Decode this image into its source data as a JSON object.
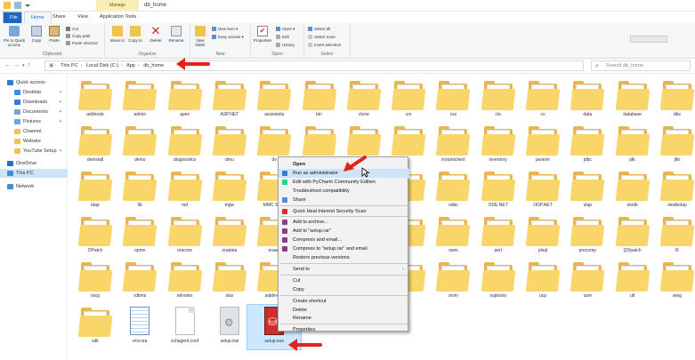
{
  "titlebar": {
    "manage_tab": "Manage",
    "title": "db_home"
  },
  "ribbon_tabs": [
    "File",
    "Home",
    "Share",
    "View",
    "Application Tools"
  ],
  "ribbon": {
    "clipboard": {
      "pin_label": "Pin to Quick access",
      "copy_label": "Copy",
      "paste_label": "Paste",
      "cut": "Cut",
      "copy_path": "Copy path",
      "paste_shortcut": "Paste shortcut",
      "group_label": "Clipboard"
    },
    "organize": {
      "move_to": "Move to",
      "copy_to": "Copy to",
      "delete": "Delete",
      "rename": "Rename",
      "group_label": "Organize"
    },
    "new": {
      "new_folder": "New folder",
      "new_item": "New item",
      "easy_access": "Easy access",
      "group_label": "New"
    },
    "open": {
      "properties": "Properties",
      "open": "Open",
      "edit": "Edit",
      "history": "History",
      "group_label": "Open"
    },
    "select": {
      "select_all": "Select all",
      "select_none": "Select none",
      "invert_selection": "Invert selection",
      "group_label": "Select"
    }
  },
  "address": {
    "crumbs": [
      "This PC",
      "Local Disk (C:)",
      "App",
      "db_home"
    ],
    "search_placeholder": "Search db_home"
  },
  "sidebar": [
    {
      "label": "Quick access",
      "color": "#2b7cd3",
      "indent": 0
    },
    {
      "label": "Desktop",
      "color": "#3c8ee0",
      "indent": 1,
      "pinned": true
    },
    {
      "label": "Downloads",
      "color": "#2f7fd6",
      "indent": 1,
      "pinned": true
    },
    {
      "label": "Documents",
      "color": "#8aa2b8",
      "indent": 1,
      "pinned": true
    },
    {
      "label": "Pictures",
      "color": "#5fa9e8",
      "indent": 1,
      "pinned": true
    },
    {
      "label": "Channel",
      "color": "#f2c14e",
      "indent": 1
    },
    {
      "label": "Website",
      "color": "#f2c14e",
      "indent": 1
    },
    {
      "label": "YouTube Setup",
      "color": "#f2c14e",
      "indent": 1,
      "pinned": true
    },
    {
      "label": "OneDrive",
      "color": "#1f6fd0",
      "indent": 0
    },
    {
      "label": "This PC",
      "color": "#3a8fd9",
      "indent": 0,
      "selected": true
    },
    {
      "label": "Network",
      "color": "#3a8fd9",
      "indent": 0
    }
  ],
  "items": [
    {
      "label": "addnode",
      "kind": "folder"
    },
    {
      "label": "admin",
      "kind": "folder"
    },
    {
      "label": "apex",
      "kind": "folder"
    },
    {
      "label": "ASP.NET",
      "kind": "folder"
    },
    {
      "label": "assistants",
      "kind": "folder"
    },
    {
      "label": "bin",
      "kind": "folder"
    },
    {
      "label": "clone",
      "kind": "folder"
    },
    {
      "label": "crs",
      "kind": "folder"
    },
    {
      "label": "css",
      "kind": "folder"
    },
    {
      "label": "ctx",
      "kind": "folder"
    },
    {
      "label": "cv",
      "kind": "folder"
    },
    {
      "label": "data",
      "kind": "folder"
    },
    {
      "label": "database",
      "kind": "folder"
    },
    {
      "label": "dbs",
      "kind": "folder"
    },
    {
      "label": "deinstall",
      "kind": "folder"
    },
    {
      "label": "demo",
      "kind": "folder"
    },
    {
      "label": "diagnostics",
      "kind": "folder"
    },
    {
      "label": "dmu",
      "kind": "folder"
    },
    {
      "label": "dv",
      "kind": "folder"
    },
    {
      "label": "",
      "kind": "folder"
    },
    {
      "label": "",
      "kind": "folder"
    },
    {
      "label": "",
      "kind": "folder"
    },
    {
      "label": "instantclient",
      "kind": "folder"
    },
    {
      "label": "inventory",
      "kind": "folder"
    },
    {
      "label": "javavm",
      "kind": "folder"
    },
    {
      "label": "jdbc",
      "kind": "folder"
    },
    {
      "label": "jdk",
      "kind": "folder"
    },
    {
      "label": "jlib",
      "kind": "folder"
    },
    {
      "label": "ldap",
      "kind": "folder"
    },
    {
      "label": "lib",
      "kind": "folder"
    },
    {
      "label": "md",
      "kind": "folder"
    },
    {
      "label": "mgw",
      "kind": "folder"
    },
    {
      "label": "MMC Snap",
      "kind": "folder"
    },
    {
      "label": "",
      "kind": "folder"
    },
    {
      "label": "",
      "kind": "folder"
    },
    {
      "label": "",
      "kind": "folder"
    },
    {
      "label": "odbc",
      "kind": "folder"
    },
    {
      "label": "ODE.NET",
      "kind": "folder"
    },
    {
      "label": "ODP.NET",
      "kind": "folder"
    },
    {
      "label": "olap",
      "kind": "folder"
    },
    {
      "label": "oledb",
      "kind": "folder"
    },
    {
      "label": "oledbolap",
      "kind": "folder"
    },
    {
      "label": "OPatch",
      "kind": "folder"
    },
    {
      "label": "opmn",
      "kind": "folder"
    },
    {
      "label": "oracore",
      "kind": "folder"
    },
    {
      "label": "oradata",
      "kind": "folder"
    },
    {
      "label": "orawe",
      "kind": "folder"
    },
    {
      "label": "",
      "kind": "folder"
    },
    {
      "label": "",
      "kind": "folder"
    },
    {
      "label": "",
      "kind": "folder"
    },
    {
      "label": "owm",
      "kind": "folder"
    },
    {
      "label": "perl",
      "kind": "folder"
    },
    {
      "label": "plsql",
      "kind": "folder"
    },
    {
      "label": "precomp",
      "kind": "folder"
    },
    {
      "label": "QOpatch",
      "kind": "folder"
    },
    {
      "label": "R",
      "kind": "folder"
    },
    {
      "label": "racg",
      "kind": "folder"
    },
    {
      "label": "rdbms",
      "kind": "folder"
    },
    {
      "label": "relnotes",
      "kind": "folder"
    },
    {
      "label": "slax",
      "kind": "folder"
    },
    {
      "label": "sqldevelo",
      "kind": "folder"
    },
    {
      "label": "",
      "kind": "folder"
    },
    {
      "label": "",
      "kind": "folder"
    },
    {
      "label": "",
      "kind": "folder"
    },
    {
      "label": "srvm",
      "kind": "folder"
    },
    {
      "label": "suptools",
      "kind": "folder"
    },
    {
      "label": "ucp",
      "kind": "folder"
    },
    {
      "label": "usm",
      "kind": "folder"
    },
    {
      "label": "utl",
      "kind": "folder"
    },
    {
      "label": "wwg",
      "kind": "folder"
    },
    {
      "label": "xdk",
      "kind": "folder"
    },
    {
      "label": "env.ora",
      "kind": "notepad"
    },
    {
      "label": "schagent.conf",
      "kind": "file"
    },
    {
      "label": "setup.bat",
      "kind": "bat"
    },
    {
      "label": "setup.exe",
      "kind": "exe",
      "selected": true
    }
  ],
  "context_menu": {
    "items": [
      {
        "label": "Open",
        "bold": true
      },
      {
        "label": "Run as administrator",
        "highlight": true,
        "icon": "#3a7bd5"
      },
      {
        "label": "Edit with PyCharm Community Edition",
        "icon": "#21d789"
      },
      {
        "label": "Troubleshoot compatibility"
      },
      {
        "label": "Share",
        "icon": "#4a90d9"
      },
      {
        "sep": true
      },
      {
        "label": "Quick Heal Internet Security Scan",
        "icon": "#d32f2f"
      },
      {
        "sep": true
      },
      {
        "label": "Add to archive...",
        "icon": "#8e3b8e"
      },
      {
        "label": "Add to \"setup.rar\"",
        "icon": "#8e3b8e"
      },
      {
        "label": "Compress and email...",
        "icon": "#8e3b8e"
      },
      {
        "label": "Compress to \"setup.rar\" and email",
        "icon": "#8e3b8e"
      },
      {
        "label": "Restore previous versions"
      },
      {
        "sep": true
      },
      {
        "label": "Send to",
        "submenu": true
      },
      {
        "sep": true
      },
      {
        "label": "Cut"
      },
      {
        "label": "Copy"
      },
      {
        "sep": true
      },
      {
        "label": "Create shortcut"
      },
      {
        "label": "Delete"
      },
      {
        "label": "Rename"
      },
      {
        "sep": true
      },
      {
        "label": "Properties"
      }
    ]
  },
  "colors": {
    "accent": "#1a66c1",
    "folder": "#fad56a",
    "annotation": "#e2231a"
  }
}
